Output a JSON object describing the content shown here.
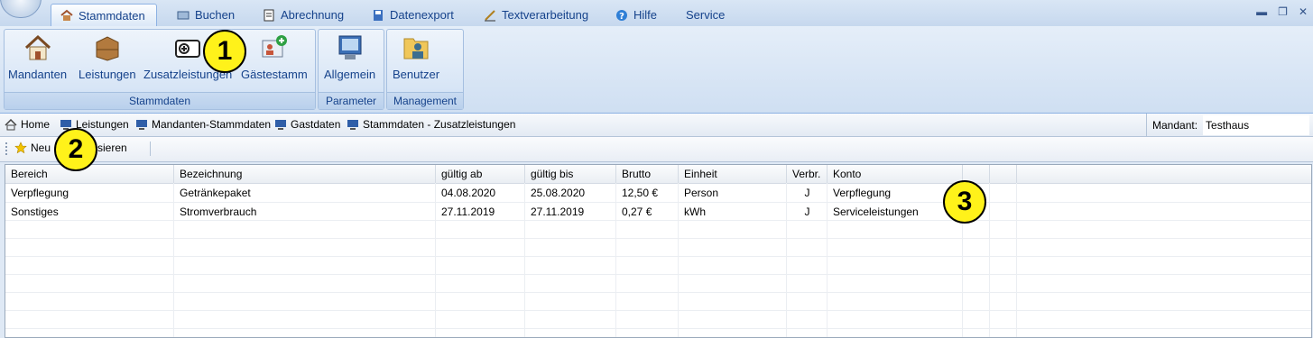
{
  "menu": {
    "tabs": [
      {
        "label": "Stammdaten",
        "icon": "house-icon",
        "active": true
      },
      {
        "label": "Buchen",
        "icon": "booking-icon"
      },
      {
        "label": "Abrechnung",
        "icon": "invoice-icon"
      },
      {
        "label": "Datenexport",
        "icon": "export-icon"
      },
      {
        "label": "Textverarbeitung",
        "icon": "pen-icon"
      },
      {
        "label": "Hilfe",
        "icon": "help-icon"
      },
      {
        "label": "Service",
        "icon": ""
      }
    ]
  },
  "ribbon": {
    "groups": [
      {
        "label": "Stammdaten",
        "buttons": [
          "Mandanten",
          "Leistungen",
          "Zusatzleistungen",
          "Gästestamm"
        ]
      },
      {
        "label": "Parameter",
        "buttons": [
          "Allgemein"
        ]
      },
      {
        "label": "Management",
        "buttons": [
          "Benutzer"
        ]
      }
    ]
  },
  "breadcrumb": {
    "items": [
      "Home",
      "Leistungen",
      "Mandanten-Stammdaten",
      "Gastdaten",
      "Stammdaten - Zusatzleistungen"
    ],
    "mandant_label": "Mandant:",
    "mandant_value": "Testhaus"
  },
  "toolbar": {
    "new_label": "Neu",
    "refresh_label": "Aktualisieren"
  },
  "table": {
    "columns": [
      "Bereich",
      "Bezeichnung",
      "gültig ab",
      "gültig bis",
      "Brutto",
      "Einheit",
      "Verbr.",
      "Konto"
    ],
    "rows": [
      [
        "Verpflegung",
        "Getränkepaket",
        "04.08.2020",
        "25.08.2020",
        "12,50 €",
        "Person",
        "J",
        "Verpflegung"
      ],
      [
        "Sonstiges",
        "Stromverbrauch",
        "27.11.2019",
        "27.11.2019",
        "0,27 €",
        "kWh",
        "J",
        "Serviceleistungen"
      ]
    ]
  },
  "callouts": [
    "1",
    "2",
    "3"
  ],
  "colors": {
    "callout": "#fff21a",
    "ribbon_text": "#15428b"
  }
}
